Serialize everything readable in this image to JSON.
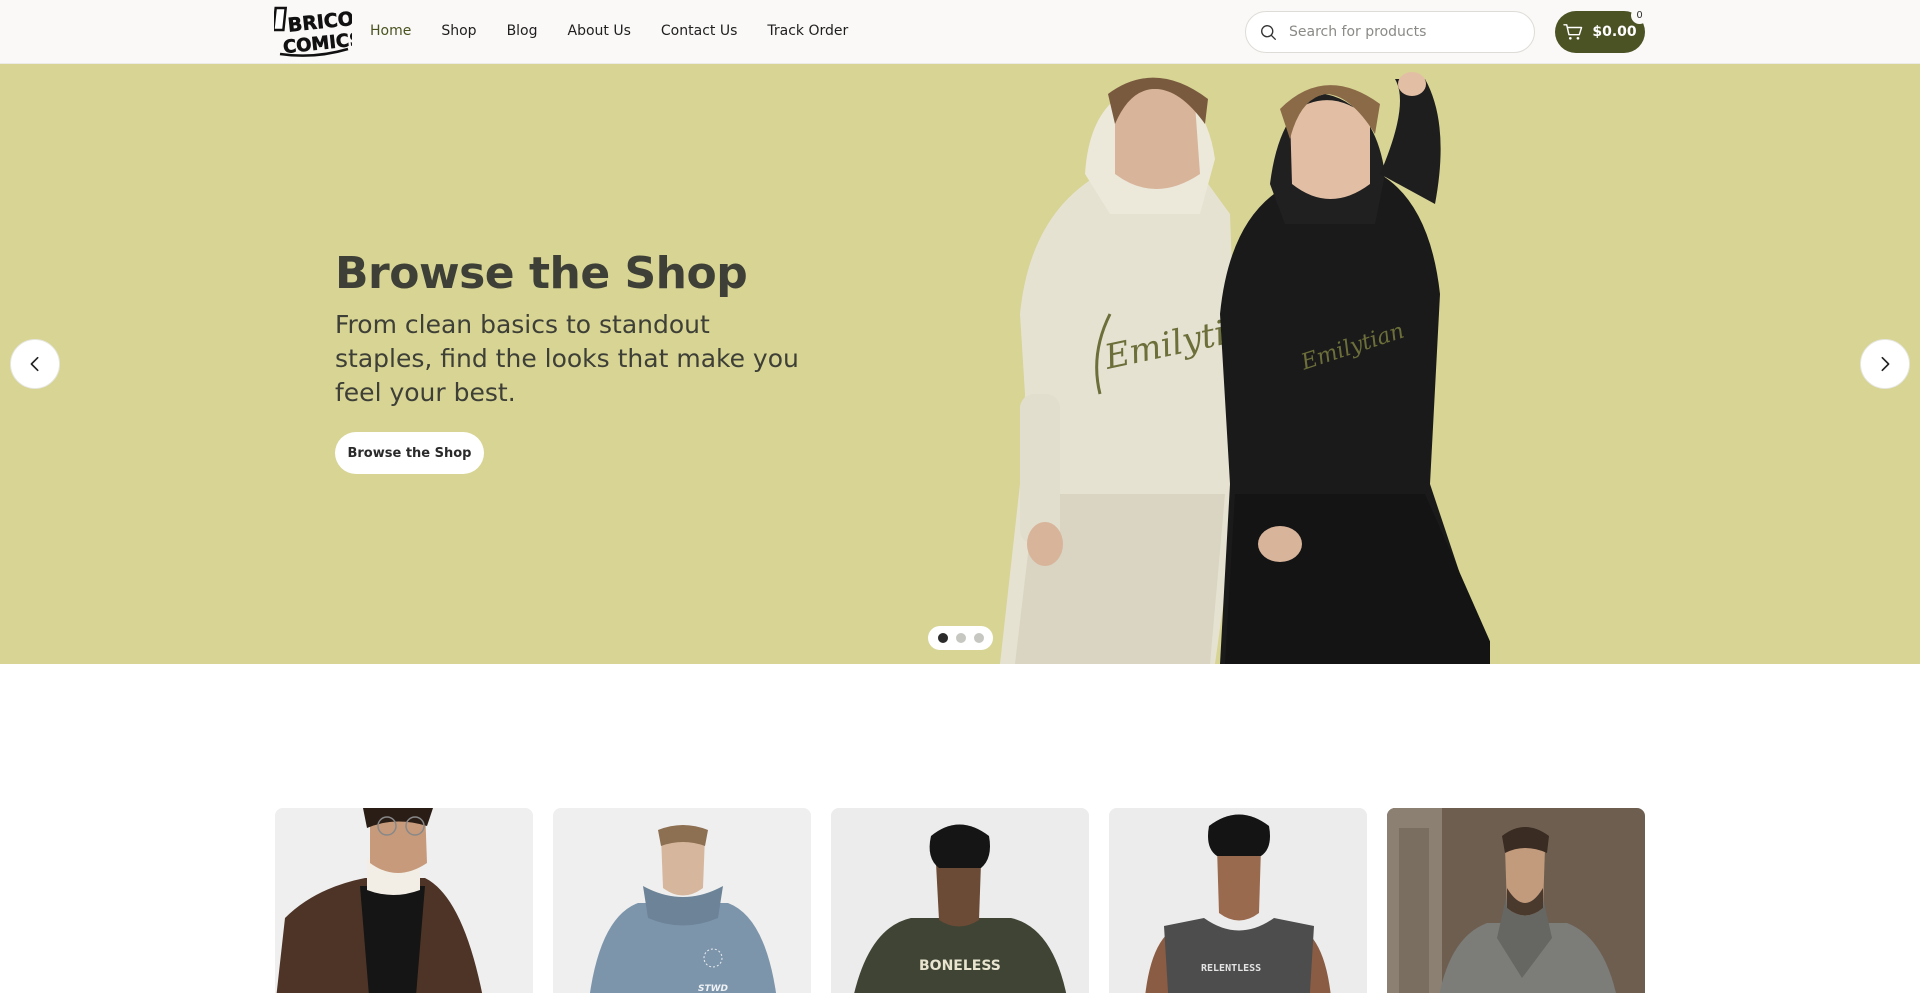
{
  "header": {
    "logo": {
      "line1": "BRICO",
      "line2": "COMICS"
    },
    "nav": [
      {
        "label": "Home",
        "active": true
      },
      {
        "label": "Shop"
      },
      {
        "label": "Blog"
      },
      {
        "label": "About Us"
      },
      {
        "label": "Contact Us"
      },
      {
        "label": "Track Order"
      }
    ],
    "search": {
      "placeholder": "Search for products",
      "icon": "search-icon"
    },
    "cart": {
      "total": "$0.00",
      "count": "0",
      "icon": "cart-icon"
    }
  },
  "hero": {
    "title": "Browse the Shop",
    "subtitle": "From clean basics to standout staples, find the looks that make you feel your best.",
    "button_label": "Browse the Shop",
    "hoodie_print": "Emilytian",
    "slide_count": 3,
    "active_slide": 1,
    "colors": {
      "background": "#d7d494",
      "accent": "#4b5224"
    }
  },
  "products": [
    {
      "name": "product-card-brown-jacket",
      "print": ""
    },
    {
      "name": "product-card-blue-hoodie",
      "print": "STWD"
    },
    {
      "name": "product-card-boneless-tee",
      "print": "BONELESS"
    },
    {
      "name": "product-card-relentless-tank",
      "print": "RELENTLESS"
    },
    {
      "name": "product-card-grey-knit",
      "print": ""
    }
  ]
}
